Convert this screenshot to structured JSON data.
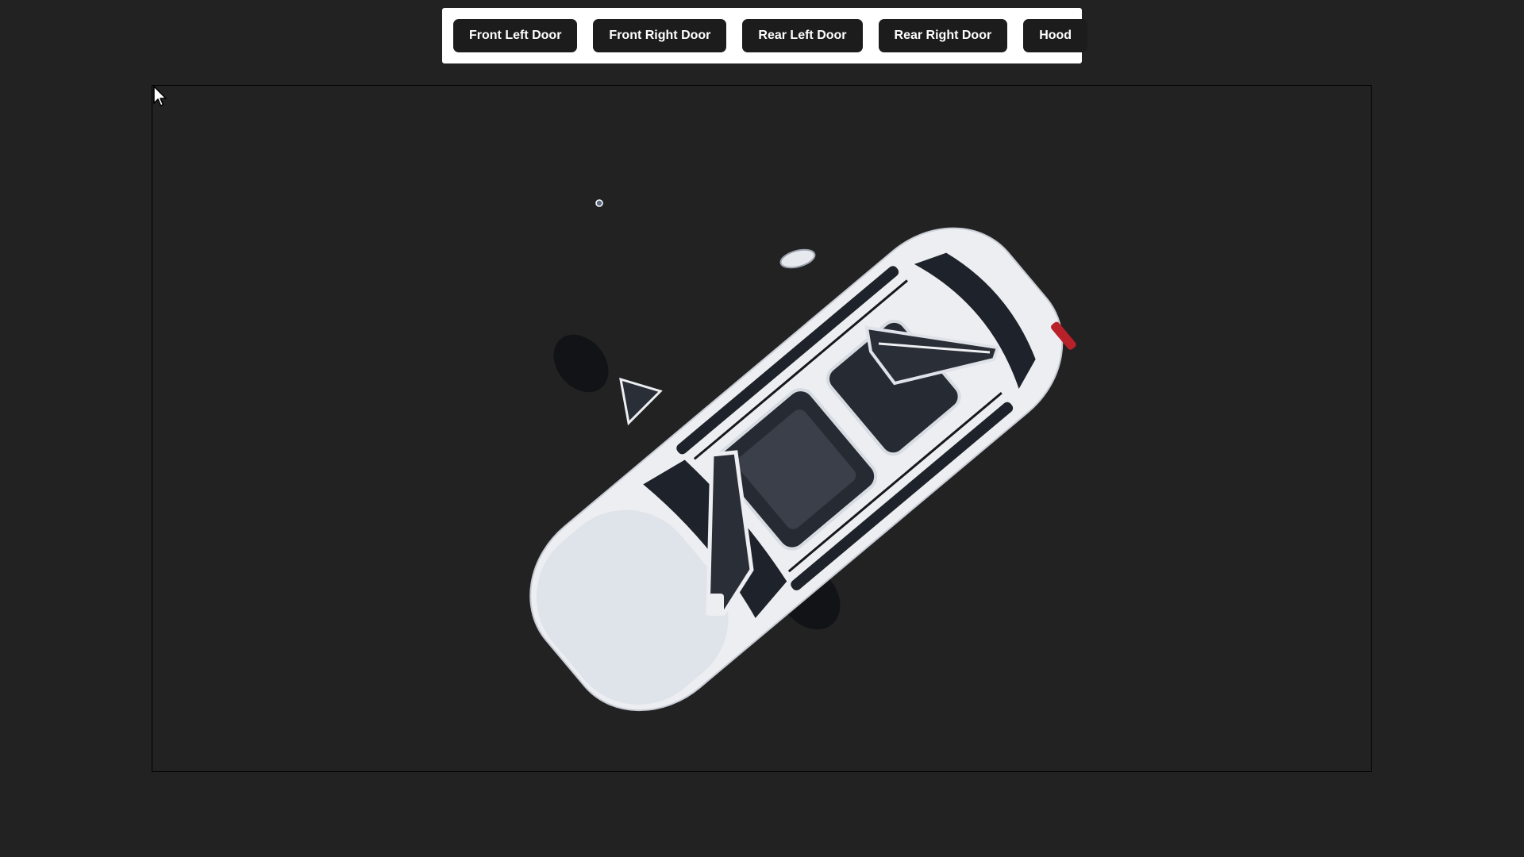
{
  "toolbar": {
    "buttons": [
      {
        "label": "Front Left Door"
      },
      {
        "label": "Front Right Door"
      },
      {
        "label": "Rear Left Door"
      },
      {
        "label": "Rear Right Door"
      },
      {
        "label": "Hood"
      }
    ]
  },
  "viewport": {
    "background": "#222222",
    "model": {
      "subject": "white SUV top view",
      "body_color": "#e8eaee",
      "glass_color": "#1e222a"
    }
  },
  "icons": {
    "cursor": "mouse-pointer-icon"
  }
}
